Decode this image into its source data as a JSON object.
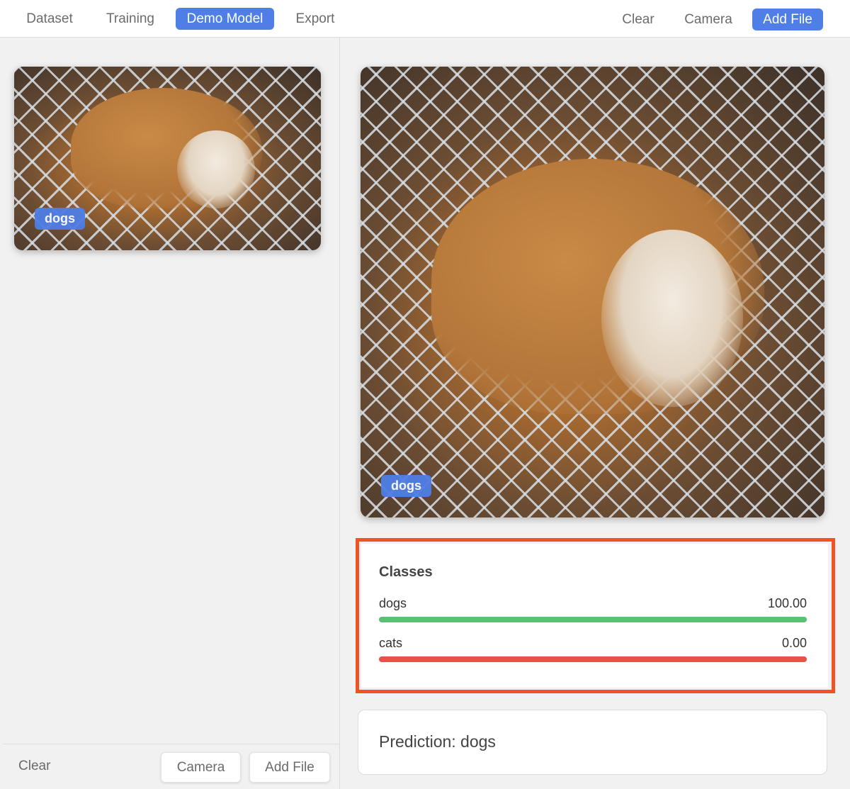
{
  "nav": {
    "tabs": [
      {
        "label": "Dataset"
      },
      {
        "label": "Training"
      },
      {
        "label": "Demo Model"
      },
      {
        "label": "Export"
      }
    ],
    "actions": {
      "clear_label": "Clear",
      "camera_label": "Camera",
      "add_file_label": "Add File"
    }
  },
  "left_panel": {
    "thumbnail": {
      "label": "dogs"
    },
    "toolbar": {
      "clear_label": "Clear",
      "camera_label": "Camera",
      "add_file_label": "Add File"
    }
  },
  "right_panel": {
    "preview": {
      "label": "dogs"
    },
    "classes": {
      "title": "Classes",
      "items": [
        {
          "name": "dogs",
          "value": "100.00",
          "level": 1.0,
          "color": "#5cbf73"
        },
        {
          "name": "cats",
          "value": "0.00",
          "level": 1.0,
          "color": "#ea5045"
        }
      ]
    },
    "prediction": {
      "text": "Prediction: dogs"
    }
  },
  "colors": {
    "accent": "#4f7ee6",
    "highlight": "#ef5425"
  }
}
